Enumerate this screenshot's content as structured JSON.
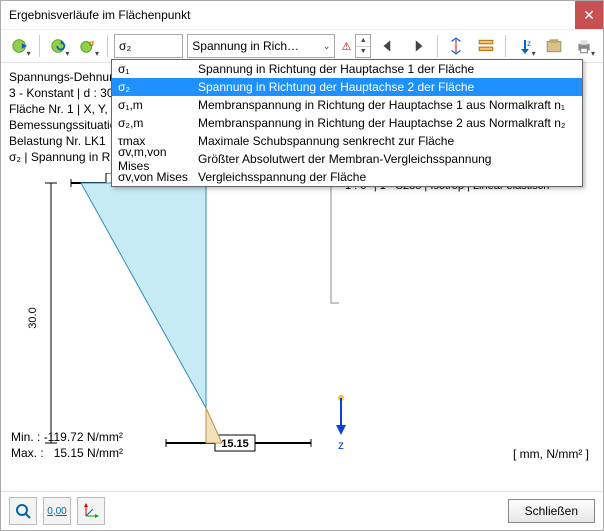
{
  "window": {
    "title": "Ergebnisverläufe im Flächenpunkt"
  },
  "toolbar": {
    "combo1_value": "σ₂",
    "combo2_value": "Spannung in Rich…"
  },
  "dropdown": {
    "items": [
      {
        "key": "σ₁",
        "desc": "Spannung in Richtung der Hauptachse 1 der Fläche"
      },
      {
        "key": "σ₂",
        "desc": "Spannung in Richtung der Hauptachse 2 der Fläche"
      },
      {
        "key": "σ₁,m",
        "desc": "Membranspannung in Richtung der Hauptachse 1 aus Normalkraft n₁"
      },
      {
        "key": "σ₂,m",
        "desc": "Membranspannung in Richtung der Hauptachse 2 aus Normalkraft n₂"
      },
      {
        "key": "τmax",
        "desc": "Maximale Schubspannung senkrecht zur Fläche"
      },
      {
        "key": "σv,m,von Mises",
        "desc": "Größter Absolutwert der Membran-Vergleichsspannung"
      },
      {
        "key": "σv,von Mises",
        "desc": "Vergleichsspannung der Fläche"
      }
    ],
    "selected_index": 1
  },
  "meta": {
    "line1": "Spannungs-Dehnun",
    "line2": "3 - Konstant | d : 30.",
    "line3": "Fläche Nr. 1 | X, Y, Z:",
    "line4": "Bemessungssituatio",
    "line5": "Belastung Nr. LK1",
    "line6": "σ₂ | Spannung in Ri"
  },
  "chart_data": {
    "type": "area",
    "top_value": -119.72,
    "bottom_value": 15.15,
    "thickness_label": "30.0",
    "axis_z": "z",
    "legend": "1 :    0°  |  1 - S235 | Isotrop | Linear elastisch",
    "min_label": "Min. :",
    "min_value": "-119.72 N/mm²",
    "max_label": "Max. :",
    "max_value": "15.15 N/mm²",
    "units": "[ mm, N/mm² ]"
  },
  "footer": {
    "close": "Schließen"
  }
}
